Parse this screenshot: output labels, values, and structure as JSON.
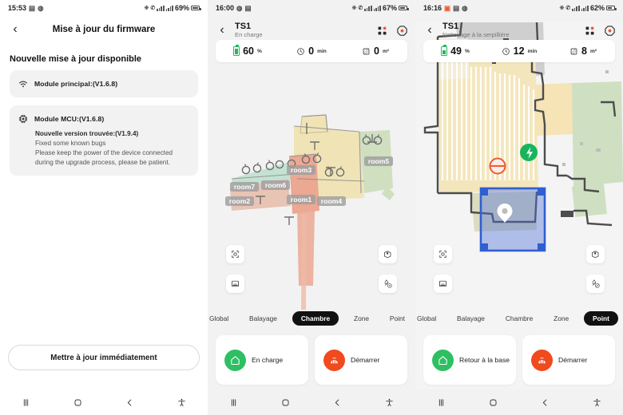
{
  "panel1": {
    "statusbar": {
      "time": "15:53",
      "battery": "69%",
      "icons": [
        "photo-icon",
        "whatsapp-icon",
        "vibrate-icon",
        "call-icon",
        "signal-icon",
        "signal-icon"
      ]
    },
    "header": {
      "back": "‹",
      "title": "Mise à jour du firmware"
    },
    "section_title": "Nouvelle mise à jour disponible",
    "cards": [
      {
        "icon": "wifi-icon",
        "label": "Module principal:(V1.6.8)",
        "detail": []
      },
      {
        "icon": "chip-icon",
        "label": "Module MCU:(V1.6.8)",
        "detail_title": "Nouvelle version trouvée:(V1.9.4)",
        "detail_lines": [
          "Fixed some known bugs",
          "Please keep the power of the device connected",
          "during the upgrade process, please be patient."
        ]
      }
    ],
    "update_button": "Mettre à jour immédiatement"
  },
  "panel2": {
    "statusbar": {
      "time": "16:00",
      "battery": "67%"
    },
    "header": {
      "back": "‹",
      "title": "TS1",
      "subtitle": "En charge",
      "icons": [
        "apps-grid-icon",
        "settings-octagon-icon"
      ]
    },
    "stats": [
      {
        "icon": "battery-icon",
        "value": "60",
        "unit": "%"
      },
      {
        "icon": "clock-icon",
        "value": "0",
        "unit": "min"
      },
      {
        "icon": "area-icon",
        "value": "0",
        "unit": "m²"
      }
    ],
    "map": {
      "rooms": [
        {
          "name": "room1",
          "color": "#e8a08f"
        },
        {
          "name": "room2",
          "color": "#e3b5a2"
        },
        {
          "name": "room3",
          "color": "#eedeb0"
        },
        {
          "name": "room4",
          "color": "#eedeb0"
        },
        {
          "name": "room5",
          "color": "#c6d9b8"
        },
        {
          "name": "room6",
          "color": "#bfe0cd"
        },
        {
          "name": "room7",
          "color": "#bfe0cd"
        }
      ]
    },
    "map_buttons": [
      "recenter-icon",
      "dock-icon",
      "edit-map-icon",
      "water-settings-icon"
    ],
    "mode_tabs": [
      {
        "label": "Global",
        "selected": false,
        "clipped": true
      },
      {
        "label": "Balayage",
        "selected": false
      },
      {
        "label": "Chambre",
        "selected": true
      },
      {
        "label": "Zone",
        "selected": false
      },
      {
        "label": "Point",
        "selected": false
      }
    ],
    "actions": [
      {
        "icon": "home-icon",
        "color": "#2fbf63",
        "label": "En charge"
      },
      {
        "icon": "robot-icon",
        "color": "#f04a1e",
        "label": "Démarrer"
      }
    ],
    "navbar": [
      "recents-icon",
      "home-icon",
      "back-icon",
      "accessibility-icon"
    ]
  },
  "panel3": {
    "statusbar": {
      "time": "16:16",
      "battery": "62%"
    },
    "header": {
      "back": "‹",
      "title": "TS1",
      "subtitle": "Nettoyage à la serpillière",
      "icons": [
        "apps-grid-icon",
        "settings-octagon-icon"
      ]
    },
    "stats": [
      {
        "icon": "battery-icon",
        "value": "49",
        "unit": "%"
      },
      {
        "icon": "clock-icon",
        "value": "12",
        "unit": "min"
      },
      {
        "icon": "area-icon",
        "value": "8",
        "unit": "m²"
      }
    ],
    "map": {
      "markers": [
        "charging-dock-icon",
        "no-go-zone-icon",
        "point-pin-icon"
      ],
      "selection_color": "#2f5fd0"
    },
    "map_buttons": [
      "recenter-icon",
      "dock-icon",
      "edit-map-icon",
      "water-settings-icon"
    ],
    "mode_tabs": [
      {
        "label": "Global",
        "selected": false,
        "clipped": true
      },
      {
        "label": "Balayage",
        "selected": false
      },
      {
        "label": "Chambre",
        "selected": false
      },
      {
        "label": "Zone",
        "selected": false
      },
      {
        "label": "Point",
        "selected": true
      }
    ],
    "actions": [
      {
        "icon": "home-icon",
        "color": "#2fbf63",
        "label": "Retour à la base"
      },
      {
        "icon": "robot-icon",
        "color": "#f04a1e",
        "label": "Démarrer"
      }
    ],
    "navbar": [
      "recents-icon",
      "home-icon",
      "back-icon",
      "accessibility-icon"
    ]
  }
}
